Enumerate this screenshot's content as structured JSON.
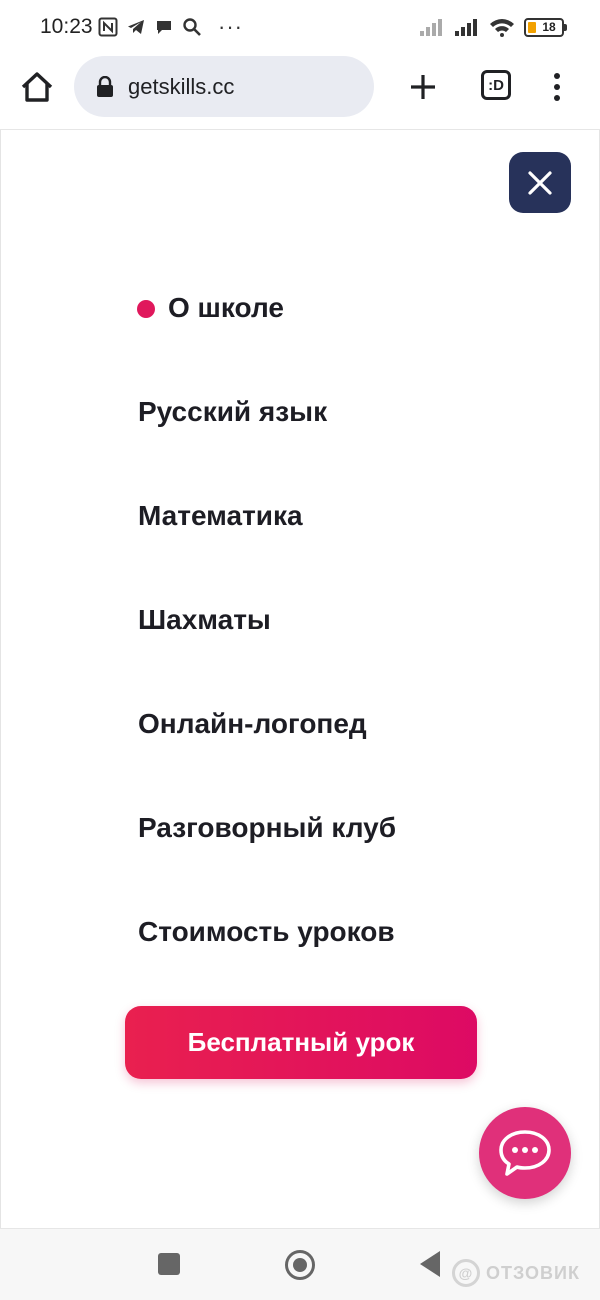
{
  "status_bar": {
    "time": "10:23",
    "battery": "18",
    "left_icons": [
      "nfc-icon",
      "telegram-icon",
      "chat-bubble-icon",
      "search-icon",
      "more-icon"
    ],
    "more_glyph": "···",
    "right_icons": [
      "signal-icon",
      "signal-icon",
      "wifi-icon",
      "battery-icon"
    ]
  },
  "browser": {
    "url": "getskills.cc",
    "tabs_label": ":D"
  },
  "menu": {
    "items": [
      {
        "label": "О школе",
        "active": true
      },
      {
        "label": "Русский язык",
        "active": false
      },
      {
        "label": "Математика",
        "active": false
      },
      {
        "label": "Шахматы",
        "active": false
      },
      {
        "label": "Онлайн-логопед",
        "active": false
      },
      {
        "label": "Разговорный клуб",
        "active": false
      },
      {
        "label": "Стоимость уроков",
        "active": false
      }
    ],
    "cta_label": "Бесплатный урок"
  },
  "watermark": {
    "text": "ОТЗОВИК",
    "mark": "@"
  },
  "colors": {
    "accent": "#e0185c",
    "close_bg": "#27325a",
    "chat_bg": "#e0307a"
  }
}
